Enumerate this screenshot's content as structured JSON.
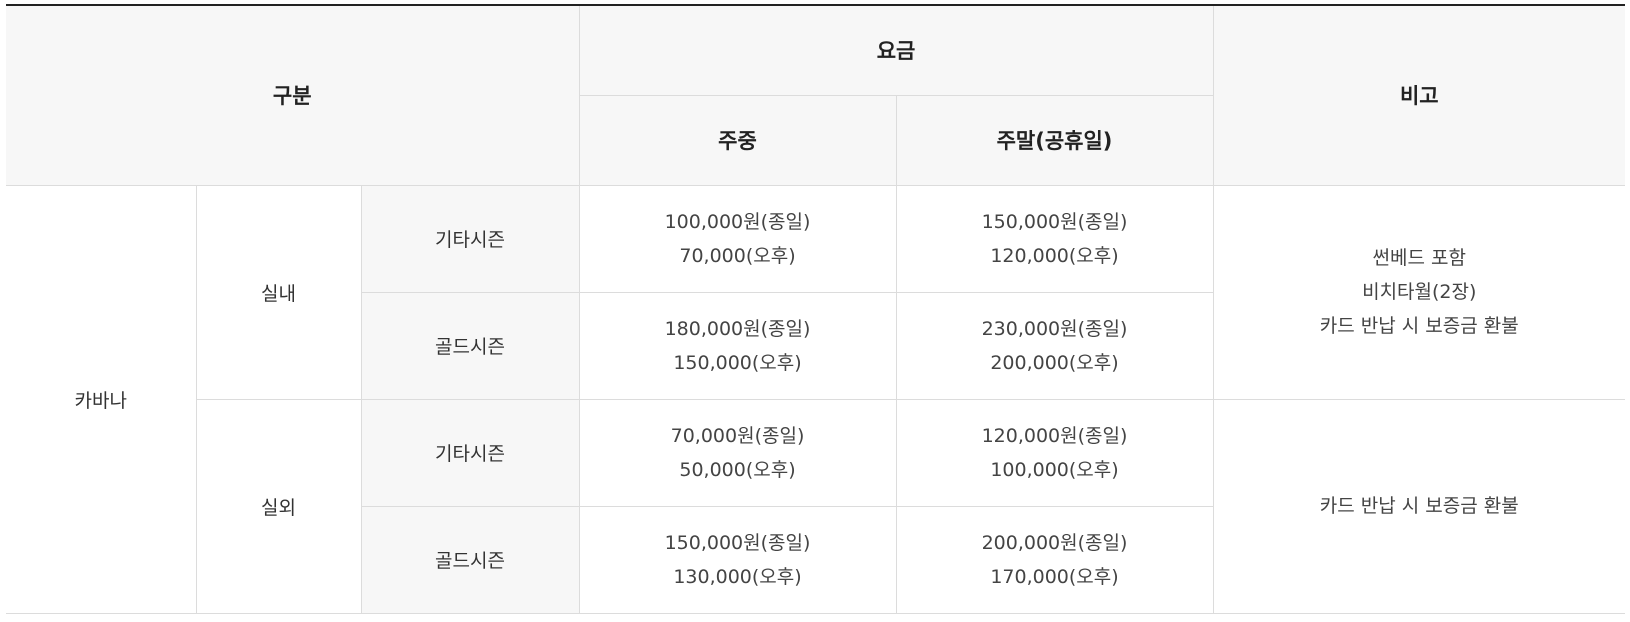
{
  "header": {
    "category": "구분",
    "fee": "요금",
    "note": "비고",
    "weekday": "주중",
    "weekend": "주말(공휴일)"
  },
  "category": "카바나",
  "groups": [
    {
      "name": "실내",
      "note_lines": [
        "썬베드 포함",
        "비치타월(2장)",
        "카드 반납 시 보증금 환불"
      ],
      "rows": [
        {
          "season": "기타시즌",
          "weekday": [
            "100,000원(종일)",
            "70,000(오후)"
          ],
          "weekend": [
            "150,000원(종일)",
            "120,000(오후)"
          ]
        },
        {
          "season": "골드시즌",
          "weekday": [
            "180,000원(종일)",
            "150,000(오후)"
          ],
          "weekend": [
            "230,000원(종일)",
            "200,000(오후)"
          ]
        }
      ]
    },
    {
      "name": "실외",
      "note_lines": [
        "카드 반납 시 보증금 환불"
      ],
      "rows": [
        {
          "season": "기타시즌",
          "weekday": [
            "70,000원(종일)",
            "50,000(오후)"
          ],
          "weekend": [
            "120,000원(종일)",
            "100,000(오후)"
          ]
        },
        {
          "season": "골드시즌",
          "weekday": [
            "150,000원(종일)",
            "130,000(오후)"
          ],
          "weekend": [
            "200,000원(종일)",
            "170,000(오후)"
          ]
        }
      ]
    }
  ]
}
